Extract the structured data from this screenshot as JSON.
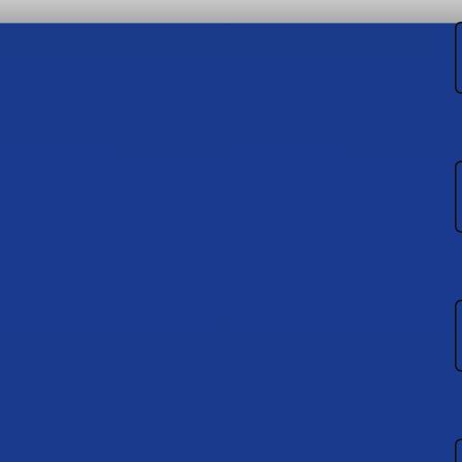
{
  "window": {
    "top_strip_color": "#bdbdbd",
    "panel_color": "#1a3a8e"
  },
  "side_tabs": [
    {
      "icon": "side-tab"
    },
    {
      "icon": "side-tab"
    },
    {
      "icon": "side-tab"
    },
    {
      "icon": "side-tab"
    }
  ]
}
